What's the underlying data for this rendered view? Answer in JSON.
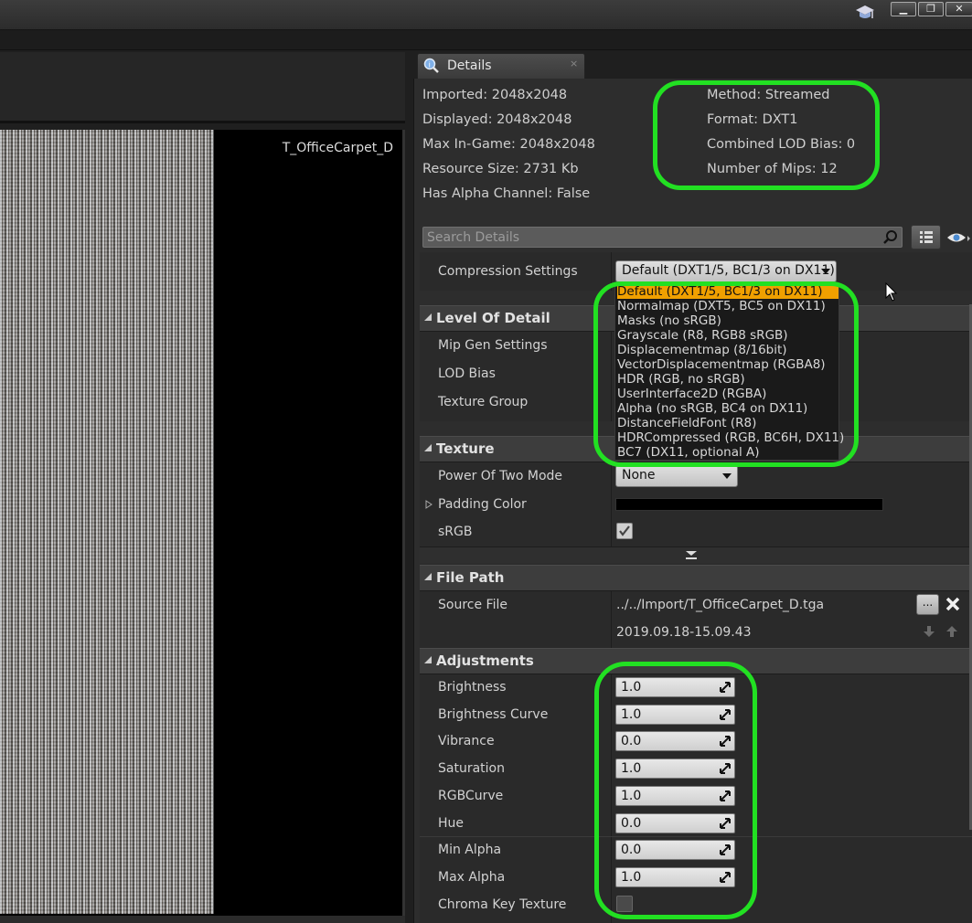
{
  "viewport": {
    "texture_name": "T_OfficeCarpet_D"
  },
  "details_tab": {
    "title": "Details",
    "close": "×"
  },
  "info": {
    "imported": "Imported: 2048x2048",
    "displayed": "Displayed: 2048x2048",
    "max_in_game": "Max In-Game: 2048x2048",
    "resource_size": "Resource Size: 2731 Kb",
    "has_alpha": "Has Alpha Channel: False",
    "method": "Method: Streamed",
    "format": "Format: DXT1",
    "lod_bias": "Combined LOD Bias: 0",
    "mips": "Number of Mips: 12"
  },
  "search": {
    "placeholder": "Search Details"
  },
  "compression": {
    "label": "Compression Settings",
    "value": "Default (DXT1/5, BC1/3 on DX11)",
    "options": [
      "Default (DXT1/5, BC1/3 on DX11)",
      "Normalmap (DXT5, BC5 on DX11)",
      "Masks (no sRGB)",
      "Grayscale (R8, RGB8 sRGB)",
      "Displacementmap (8/16bit)",
      "VectorDisplacementmap (RGBA8)",
      "HDR (RGB, no sRGB)",
      "UserInterface2D (RGBA)",
      "Alpha (no sRGB, BC4 on DX11)",
      "DistanceFieldFont (R8)",
      "HDRCompressed (RGB, BC6H, DX11)",
      "BC7 (DX11, optional A)"
    ]
  },
  "lod": {
    "title": "Level Of Detail",
    "mip_gen": "Mip Gen Settings",
    "lod_bias": "LOD Bias",
    "texture_group": "Texture Group"
  },
  "texture": {
    "title": "Texture",
    "power_of_two": "Power Of Two Mode",
    "power_of_two_value": "None",
    "padding_color": "Padding Color",
    "srgb": "sRGB",
    "srgb_checked": true
  },
  "file_path": {
    "title": "File Path",
    "source_file": "Source File",
    "path": "../../Import/T_OfficeCarpet_D.tga",
    "browse": "...",
    "timestamp": "2019.09.18-15.09.43"
  },
  "adjustments": {
    "title": "Adjustments",
    "rows": [
      {
        "label": "Brightness",
        "value": "1.0"
      },
      {
        "label": "Brightness Curve",
        "value": "1.0"
      },
      {
        "label": "Vibrance",
        "value": "0.0"
      },
      {
        "label": "Saturation",
        "value": "1.0"
      },
      {
        "label": "RGBCurve",
        "value": "1.0"
      },
      {
        "label": "Hue",
        "value": "0.0"
      },
      {
        "label": "Min Alpha",
        "value": "0.0"
      },
      {
        "label": "Max Alpha",
        "value": "1.0"
      }
    ],
    "chroma_key": "Chroma Key Texture",
    "chroma_key_checked": false
  },
  "colors": {
    "highlight": "#22e022",
    "selected": "#f0a000"
  }
}
